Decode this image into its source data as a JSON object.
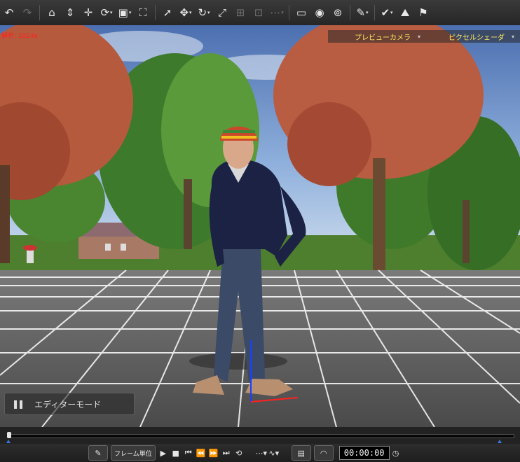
{
  "toolbar": {
    "buttons": [
      "undo-icon",
      "redo-icon",
      "home-icon",
      "move-up-down-icon",
      "move-all-icon",
      "rotate-icon",
      "scale-box-icon",
      "fit-icon",
      "select-arrow-icon",
      "move-gizmo-icon",
      "orbit-icon",
      "resize-icon",
      "align-icon",
      "group-icon",
      "link-icon",
      "window-icon",
      "preview-icon",
      "render-icon",
      "brush-icon",
      "check-icon",
      "terrain-icon",
      "flag-icon"
    ]
  },
  "viewport": {
    "red_label": "解析: 1024x",
    "camera": "プレビューカメラ",
    "shader": "ピクセルシェーダ",
    "editor_mode": "エディターモード"
  },
  "timeline": {
    "position": 0.0
  },
  "transport": {
    "frame_unit": "フレーム単位",
    "timecode": "00:00:00"
  },
  "colors": {
    "sky": "#6a8ec8",
    "grid_floor": "#555555",
    "accent_text": "#ffe866",
    "timeline_marker": "#3c72d8"
  }
}
